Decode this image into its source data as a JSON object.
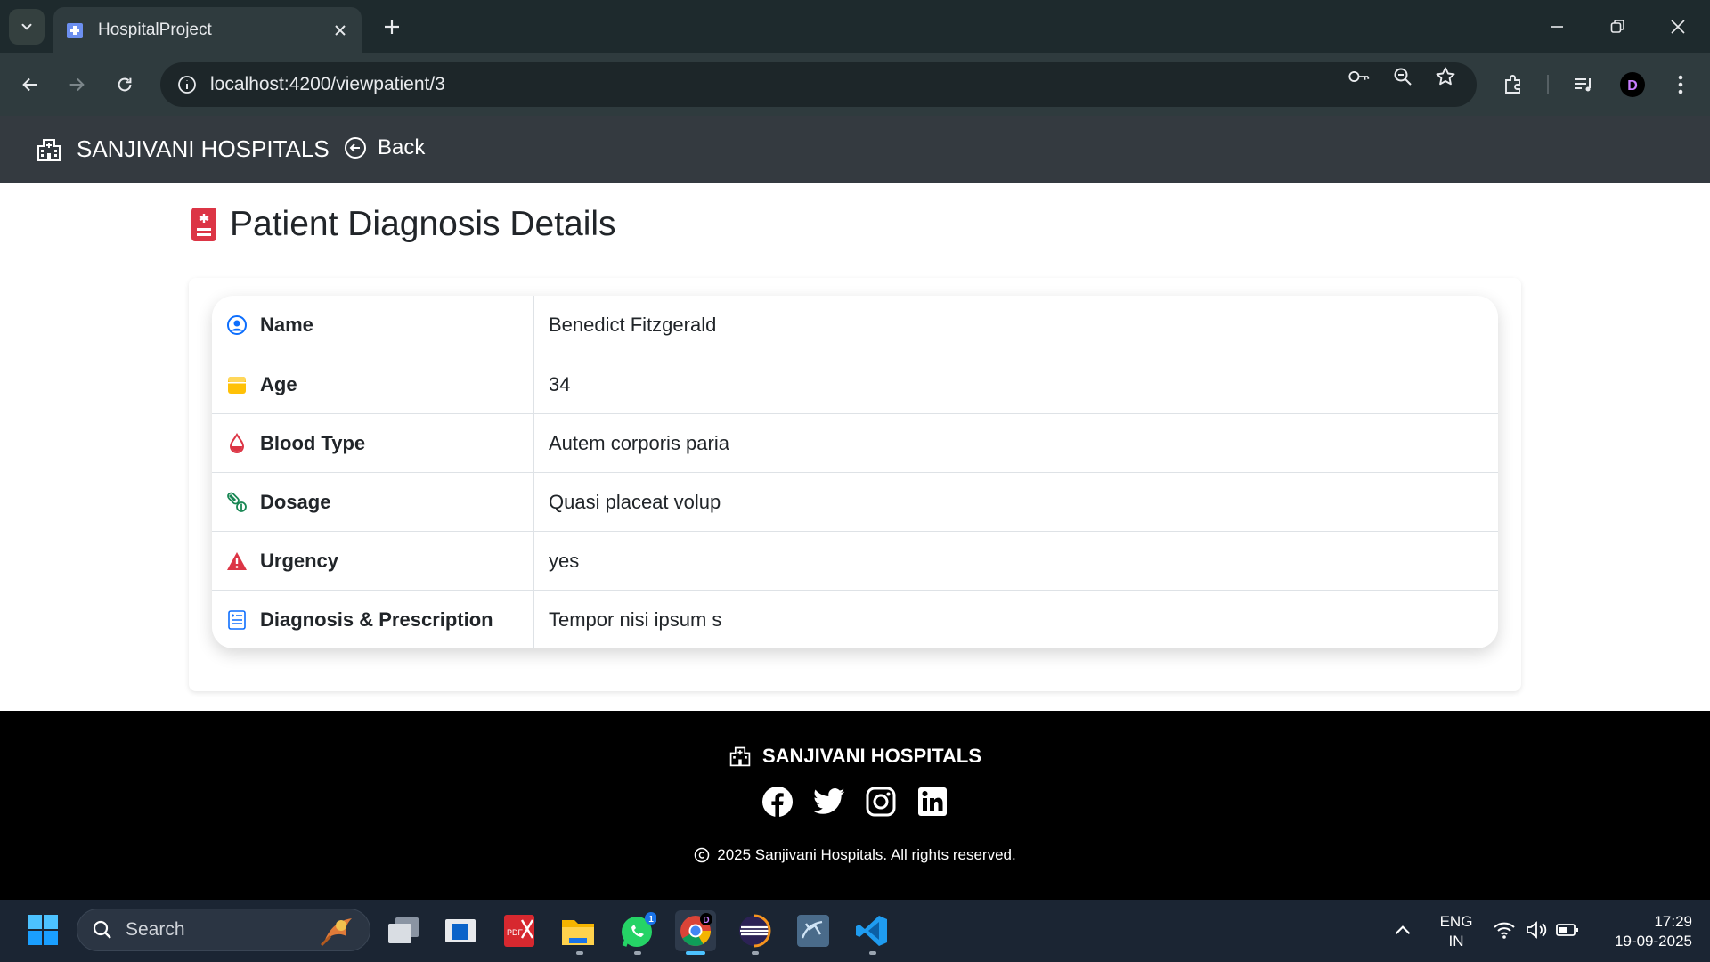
{
  "browser": {
    "tab_title": "HospitalProject",
    "url": "localhost:4200/viewpatient/3",
    "profile_initial": "D"
  },
  "app": {
    "brand": "SANJIVANI HOSPITALS",
    "back_label": "Back",
    "page_title": "Patient Diagnosis Details"
  },
  "details": [
    {
      "label": "Name",
      "value": "Benedict Fitzgerald",
      "icon": "user-circle-icon",
      "icon_color": "#0d6efd"
    },
    {
      "label": "Age",
      "value": "34",
      "icon": "calendar-icon",
      "icon_color": "#ffc107"
    },
    {
      "label": "Blood Type",
      "value": "Autem corporis paria",
      "icon": "blood-drop-icon",
      "icon_color": "#dc3545"
    },
    {
      "label": "Dosage",
      "value": "Quasi placeat volup",
      "icon": "capsule-icon",
      "icon_color": "#198754"
    },
    {
      "label": "Urgency",
      "value": "yes",
      "icon": "warning-triangle-icon",
      "icon_color": "#dc3545"
    },
    {
      "label": "Diagnosis & Prescription",
      "value": "Tempor nisi ipsum s",
      "icon": "medical-report-icon",
      "icon_color": "#0d6efd"
    }
  ],
  "footer": {
    "brand": "SANJIVANI HOSPITALS",
    "copyright": "2025 Sanjivani Hospitals. All rights reserved.",
    "socials": [
      "facebook-icon",
      "twitter-icon",
      "instagram-icon",
      "linkedin-icon"
    ]
  },
  "taskbar": {
    "search_label": "Search",
    "lang_line1": "ENG",
    "lang_line2": "IN",
    "time": "17:29",
    "date": "19-09-2025",
    "whatsapp_badge": "1"
  }
}
